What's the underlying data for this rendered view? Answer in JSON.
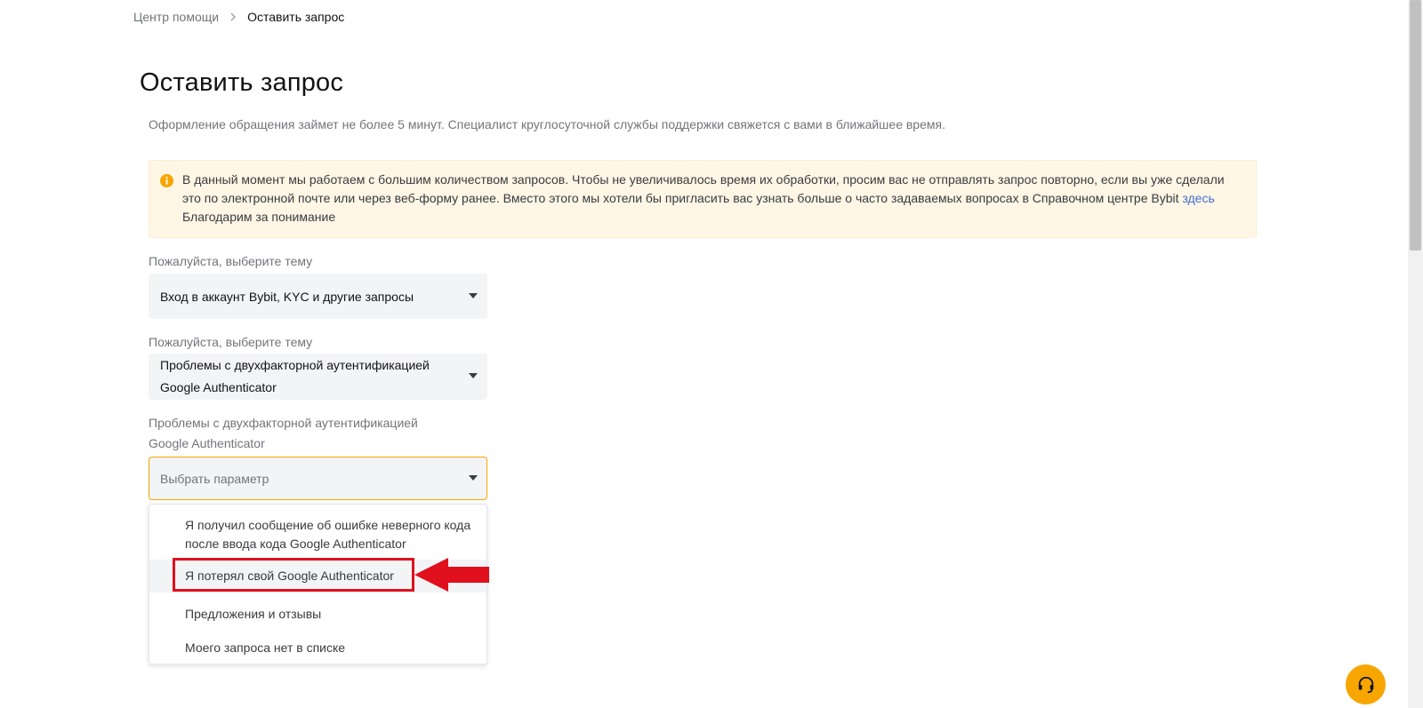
{
  "breadcrumb": {
    "home": "Центр помощи",
    "current": "Оставить запрос"
  },
  "page": {
    "title": "Оставить запрос",
    "subtitle": "Оформление обращения займет не более 5 минут. Специалист круглосуточной службы поддержки свяжется с вами в ближайшее время."
  },
  "notice": {
    "text_part1": "В данный момент мы работаем с большим количеством запросов. Чтобы не увеличивалось время их обработки, просим вас не отправлять запрос повторно, если вы уже сделали это по электронной почте или через веб-форму ранее. Вместо этого мы хотели бы пригласить вас узнать больше о часто задаваемых вопросах в Справочном центре Bybit ",
    "link": "здесь",
    "text_part2": "Благодарим за понимание",
    "icon": "info-icon"
  },
  "form": {
    "topic1": {
      "label": "Пожалуйста, выберите тему",
      "value": "Вход в аккаунт Bybit, KYC и другие запросы"
    },
    "topic2": {
      "label": "Пожалуйста, выберите тему",
      "value_line1": "Проблемы с двухфакторной аутентификацией",
      "value_line2": "Google Authenticator"
    },
    "topic3": {
      "label_line1": "Проблемы с двухфакторной аутентификацией",
      "label_line2": "Google Authenticator",
      "placeholder": "Выбрать параметр"
    },
    "options": [
      {
        "line1": "Я получил сообщение об ошибке неверного кода",
        "line2": "после ввода кода Google Authenticator"
      },
      {
        "line1": "Я потерял свой Google Authenticator"
      },
      {
        "line1": "Предложения и отзывы"
      },
      {
        "line1": "Моего запроса нет в списке"
      }
    ]
  },
  "colors": {
    "accent": "#f7a600",
    "annotation": "#e0101e",
    "link": "#3e6fd4"
  }
}
